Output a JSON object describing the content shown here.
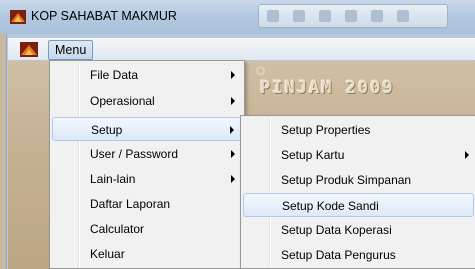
{
  "window": {
    "title": "KOP SAHABAT MAKMUR"
  },
  "menubar": {
    "menu_label": "Menu"
  },
  "background": {
    "banner": "PINJAM 2009",
    "small_mark": "O"
  },
  "dropdown": {
    "items": [
      {
        "label": "File Data",
        "submenu": true
      },
      {
        "label": "Operasional",
        "submenu": true
      },
      {
        "label": "Setup",
        "submenu": true,
        "active": true
      },
      {
        "label": "User / Password",
        "submenu": true
      },
      {
        "label": "Lain-lain",
        "submenu": true
      },
      {
        "label": "Daftar Laporan",
        "submenu": false
      },
      {
        "label": "Calculator",
        "submenu": false
      },
      {
        "label": "Keluar",
        "submenu": false
      }
    ]
  },
  "submenu": {
    "items": [
      {
        "label": "Setup Properties",
        "submenu": false
      },
      {
        "label": "Setup Kartu",
        "submenu": true
      },
      {
        "label": "Setup Produk Simpanan",
        "submenu": false
      },
      {
        "label": "Setup Kode Sandi",
        "submenu": false,
        "active": true
      },
      {
        "label": "Setup Data Koperasi",
        "submenu": false
      },
      {
        "label": "Setup Data Pengurus",
        "submenu": false
      }
    ]
  },
  "colors": {
    "highlight_border": "#aecbef",
    "menu_bg": "#f1f1f1"
  }
}
